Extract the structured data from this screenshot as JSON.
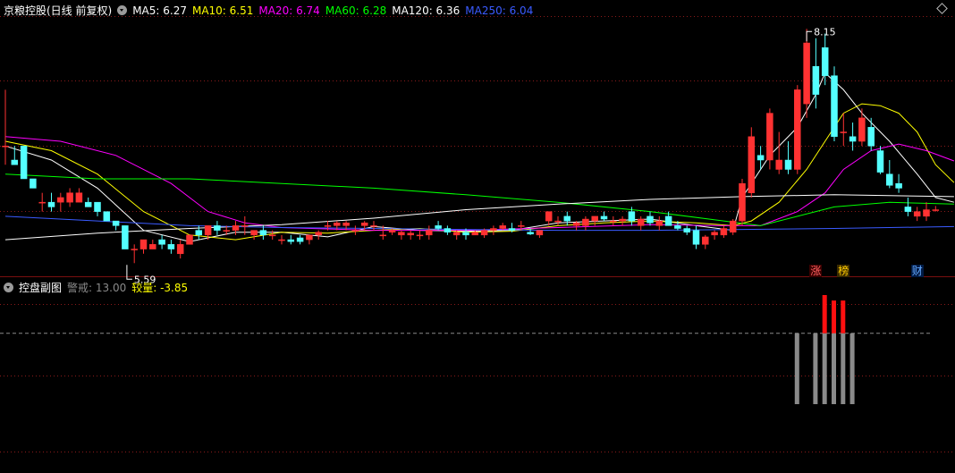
{
  "header": {
    "stock_name": "京粮控股(日线 前复权)",
    "ma": [
      {
        "label": "MA5: 6.27",
        "color": "#ffffff"
      },
      {
        "label": "MA10: 6.51",
        "color": "#ffff00"
      },
      {
        "label": "MA20: 6.74",
        "color": "#ff00ff"
      },
      {
        "label": "MA60: 6.28",
        "color": "#00ff00"
      },
      {
        "label": "MA120: 6.36",
        "color": "#ffffff"
      },
      {
        "label": "MA250: 6.04",
        "color": "#3a5bff"
      }
    ]
  },
  "sub_header": {
    "indicator_name": "控盘副图",
    "warning_label": "警戒: 13.00",
    "compare_label": "较量: -3.85"
  },
  "colors": {
    "up": "#ff3232",
    "down": "#54ffff",
    "bg": "#000000",
    "grid": "#8b1a1a"
  },
  "chart_data": {
    "type": "candlestick",
    "high_marker": "8.15",
    "low_marker": "5.59",
    "candles": [
      [
        6.9,
        7.5,
        6.7,
        6.9
      ],
      [
        6.75,
        6.9,
        6.7,
        6.7
      ],
      [
        6.9,
        6.9,
        6.55,
        6.55
      ],
      [
        6.55,
        6.55,
        6.45,
        6.45
      ],
      [
        6.3,
        6.4,
        6.2,
        6.3
      ],
      [
        6.3,
        6.4,
        6.2,
        6.25
      ],
      [
        6.3,
        6.4,
        6.2,
        6.35
      ],
      [
        6.3,
        6.45,
        6.25,
        6.4
      ],
      [
        6.3,
        6.45,
        6.3,
        6.4
      ],
      [
        6.3,
        6.35,
        6.25,
        6.25
      ],
      [
        6.3,
        6.3,
        6.15,
        6.2
      ],
      [
        6.2,
        6.2,
        6.1,
        6.1
      ],
      [
        6.1,
        6.1,
        6.0,
        6.05
      ],
      [
        6.05,
        6.05,
        5.8,
        5.8
      ],
      [
        5.8,
        5.85,
        5.65,
        5.8
      ],
      [
        5.8,
        5.9,
        5.75,
        5.9
      ],
      [
        5.8,
        5.9,
        5.8,
        5.85
      ],
      [
        5.9,
        5.95,
        5.8,
        5.85
      ],
      [
        5.85,
        5.9,
        5.75,
        5.8
      ],
      [
        5.75,
        5.9,
        5.7,
        5.85
      ],
      [
        5.85,
        5.95,
        5.85,
        5.95
      ],
      [
        6.0,
        6.05,
        5.9,
        5.95
      ],
      [
        5.95,
        6.05,
        5.9,
        6.05
      ],
      [
        6.05,
        6.1,
        5.95,
        6.0
      ],
      [
        6.0,
        6.05,
        5.95,
        6.0
      ],
      [
        6.0,
        6.1,
        5.95,
        6.05
      ],
      [
        6.05,
        6.15,
        5.95,
        6.05
      ],
      [
        5.95,
        6.0,
        5.9,
        6.0
      ],
      [
        6.0,
        6.05,
        5.9,
        5.95
      ],
      [
        5.95,
        6.0,
        5.9,
        5.95
      ],
      [
        5.9,
        5.95,
        5.85,
        5.9
      ],
      [
        5.9,
        5.95,
        5.85,
        5.88
      ],
      [
        5.92,
        5.95,
        5.85,
        5.88
      ],
      [
        5.9,
        5.95,
        5.85,
        5.95
      ],
      [
        5.95,
        6.0,
        5.9,
        5.98
      ],
      [
        6.05,
        6.1,
        6.0,
        6.05
      ],
      [
        6.05,
        6.1,
        6.0,
        6.08
      ],
      [
        6.05,
        6.1,
        6.0,
        6.08
      ],
      [
        6.0,
        6.05,
        5.95,
        6.0
      ],
      [
        6.05,
        6.1,
        6.0,
        6.08
      ],
      [
        6.05,
        6.1,
        6.0,
        6.05
      ],
      [
        5.95,
        6.05,
        5.9,
        5.95
      ],
      [
        5.98,
        6.02,
        5.95,
        6.0
      ],
      [
        5.95,
        6.0,
        5.9,
        5.98
      ],
      [
        5.95,
        6.0,
        5.9,
        5.97
      ],
      [
        5.95,
        6.0,
        5.9,
        5.95
      ],
      [
        5.95,
        6.05,
        5.9,
        6.0
      ],
      [
        6.05,
        6.1,
        6.0,
        6.02
      ],
      [
        6.02,
        6.05,
        5.95,
        5.98
      ],
      [
        5.95,
        6.0,
        5.9,
        5.98
      ],
      [
        5.98,
        6.02,
        5.9,
        5.95
      ],
      [
        5.95,
        6.0,
        5.95,
        5.98
      ],
      [
        5.95,
        6.02,
        5.92,
        6.0
      ],
      [
        6.0,
        6.05,
        5.95,
        6.02
      ],
      [
        6.02,
        6.08,
        6.0,
        6.05
      ],
      [
        6.02,
        6.08,
        5.98,
        6.0
      ],
      [
        6.05,
        6.1,
        6.0,
        6.05
      ],
      [
        5.98,
        6.02,
        5.95,
        5.96
      ],
      [
        5.95,
        6.0,
        5.92,
        6.0
      ],
      [
        6.1,
        6.2,
        6.05,
        6.2
      ],
      [
        6.1,
        6.15,
        6.05,
        6.1
      ],
      [
        6.15,
        6.2,
        6.05,
        6.1
      ],
      [
        6.05,
        6.1,
        6.0,
        6.08
      ],
      [
        6.05,
        6.15,
        6.0,
        6.12
      ],
      [
        6.1,
        6.15,
        6.05,
        6.15
      ],
      [
        6.15,
        6.2,
        6.1,
        6.12
      ],
      [
        6.1,
        6.15,
        6.05,
        6.1
      ],
      [
        6.1,
        6.15,
        6.05,
        6.12
      ],
      [
        6.2,
        6.25,
        6.05,
        6.1
      ],
      [
        6.05,
        6.15,
        6.0,
        6.12
      ],
      [
        6.15,
        6.2,
        6.05,
        6.08
      ],
      [
        6.05,
        6.15,
        6.0,
        6.1
      ],
      [
        6.15,
        6.2,
        6.05,
        6.05
      ],
      [
        6.05,
        6.1,
        6.0,
        6.02
      ],
      [
        6.02,
        6.05,
        5.95,
        5.98
      ],
      [
        6.0,
        6.05,
        5.8,
        5.85
      ],
      [
        5.85,
        5.95,
        5.8,
        5.93
      ],
      [
        5.95,
        6.0,
        5.9,
        5.98
      ],
      [
        5.95,
        6.05,
        5.92,
        6.02
      ],
      [
        5.98,
        6.12,
        5.95,
        6.1
      ],
      [
        6.1,
        6.55,
        6.05,
        6.5
      ],
      [
        6.4,
        7.1,
        6.35,
        7.0
      ],
      [
        6.8,
        6.9,
        6.65,
        6.75
      ],
      [
        6.75,
        7.3,
        6.65,
        7.25
      ],
      [
        6.65,
        7.05,
        6.6,
        6.75
      ],
      [
        6.75,
        6.95,
        6.6,
        6.65
      ],
      [
        6.65,
        7.55,
        6.6,
        7.5
      ],
      [
        7.35,
        8.15,
        7.2,
        8.0
      ],
      [
        7.75,
        8.05,
        7.3,
        7.45
      ],
      [
        7.95,
        8.1,
        7.55,
        7.65
      ],
      [
        7.65,
        7.75,
        6.95,
        7.0
      ],
      [
        7.05,
        7.25,
        6.9,
        7.05
      ],
      [
        7.0,
        7.15,
        6.85,
        6.95
      ],
      [
        6.95,
        7.3,
        6.9,
        7.2
      ],
      [
        7.1,
        7.2,
        6.85,
        6.9
      ],
      [
        6.85,
        6.9,
        6.6,
        6.62
      ],
      [
        6.6,
        6.75,
        6.45,
        6.48
      ],
      [
        6.5,
        6.6,
        6.4,
        6.45
      ],
      [
        6.25,
        6.35,
        6.15,
        6.2
      ],
      [
        6.15,
        6.25,
        6.1,
        6.2
      ],
      [
        6.15,
        6.3,
        6.1,
        6.22
      ],
      [
        6.22,
        6.26,
        6.2,
        6.22
      ]
    ],
    "ma_lines": [
      {
        "name": "MA5",
        "color": "#ffffff",
        "values": [
          [
            0,
            6.9
          ],
          [
            5,
            6.75
          ],
          [
            10,
            6.45
          ],
          [
            15,
            6.0
          ],
          [
            20,
            5.88
          ],
          [
            25,
            5.98
          ],
          [
            30,
            5.98
          ],
          [
            35,
            5.93
          ],
          [
            40,
            6.04
          ],
          [
            45,
            6.0
          ],
          [
            50,
            5.99
          ],
          [
            55,
            6.0
          ],
          [
            60,
            6.08
          ],
          [
            65,
            6.1
          ],
          [
            70,
            6.12
          ],
          [
            75,
            6.05
          ],
          [
            79,
            6.0
          ],
          [
            80,
            6.35
          ],
          [
            83,
            6.8
          ],
          [
            86,
            7.1
          ],
          [
            88,
            7.45
          ],
          [
            89,
            7.68
          ],
          [
            91,
            7.5
          ],
          [
            93,
            7.25
          ],
          [
            96,
            6.95
          ],
          [
            99,
            6.6
          ],
          [
            101,
            6.35
          ],
          [
            103,
            6.3
          ]
        ]
      },
      {
        "name": "MA10",
        "color": "#ffff00",
        "values": [
          [
            0,
            6.95
          ],
          [
            5,
            6.85
          ],
          [
            10,
            6.6
          ],
          [
            15,
            6.2
          ],
          [
            20,
            5.95
          ],
          [
            25,
            5.9
          ],
          [
            30,
            5.98
          ],
          [
            35,
            5.97
          ],
          [
            40,
            6.0
          ],
          [
            45,
            6.02
          ],
          [
            50,
            5.98
          ],
          [
            55,
            5.99
          ],
          [
            60,
            6.05
          ],
          [
            65,
            6.08
          ],
          [
            70,
            6.1
          ],
          [
            75,
            6.08
          ],
          [
            79,
            6.05
          ],
          [
            81,
            6.1
          ],
          [
            84,
            6.3
          ],
          [
            87,
            6.65
          ],
          [
            89,
            6.95
          ],
          [
            91,
            7.25
          ],
          [
            93,
            7.35
          ],
          [
            95,
            7.33
          ],
          [
            97,
            7.25
          ],
          [
            99,
            7.05
          ],
          [
            101,
            6.7
          ],
          [
            103,
            6.51
          ]
        ]
      },
      {
        "name": "MA20",
        "color": "#ff00ff",
        "values": [
          [
            0,
            7.0
          ],
          [
            6,
            6.95
          ],
          [
            12,
            6.8
          ],
          [
            18,
            6.5
          ],
          [
            22,
            6.2
          ],
          [
            26,
            6.08
          ],
          [
            30,
            6.03
          ],
          [
            40,
            6.0
          ],
          [
            50,
            6.0
          ],
          [
            60,
            6.03
          ],
          [
            70,
            6.06
          ],
          [
            78,
            6.05
          ],
          [
            82,
            6.05
          ],
          [
            86,
            6.2
          ],
          [
            89,
            6.4
          ],
          [
            91,
            6.65
          ],
          [
            94,
            6.85
          ],
          [
            97,
            6.92
          ],
          [
            100,
            6.85
          ],
          [
            103,
            6.74
          ]
        ]
      },
      {
        "name": "MA60",
        "color": "#00ff00",
        "values": [
          [
            0,
            6.6
          ],
          [
            10,
            6.55
          ],
          [
            20,
            6.55
          ],
          [
            30,
            6.5
          ],
          [
            40,
            6.45
          ],
          [
            50,
            6.38
          ],
          [
            60,
            6.3
          ],
          [
            70,
            6.2
          ],
          [
            78,
            6.1
          ],
          [
            82,
            6.05
          ],
          [
            86,
            6.15
          ],
          [
            90,
            6.25
          ],
          [
            96,
            6.3
          ],
          [
            103,
            6.28
          ]
        ]
      },
      {
        "name": "MA120",
        "color": "#ffffff",
        "values": [
          [
            0,
            5.9
          ],
          [
            10,
            5.97
          ],
          [
            20,
            6.02
          ],
          [
            30,
            6.06
          ],
          [
            40,
            6.13
          ],
          [
            50,
            6.22
          ],
          [
            60,
            6.28
          ],
          [
            70,
            6.33
          ],
          [
            80,
            6.36
          ],
          [
            90,
            6.38
          ],
          [
            103,
            6.36
          ]
        ]
      },
      {
        "name": "MA250",
        "color": "#3a5bff",
        "values": [
          [
            0,
            6.15
          ],
          [
            10,
            6.1
          ],
          [
            20,
            6.05
          ],
          [
            30,
            6.03
          ],
          [
            40,
            6.02
          ],
          [
            50,
            6.01
          ],
          [
            60,
            6.0
          ],
          [
            70,
            6.0
          ],
          [
            80,
            6.01
          ],
          [
            90,
            6.02
          ],
          [
            103,
            6.04
          ]
        ]
      }
    ],
    "badges": [
      {
        "text": "涨",
        "index": 88,
        "color": "#ff6060",
        "bg": "#3a0000"
      },
      {
        "text": "榜",
        "index": 91,
        "color": "#ffcc00",
        "bg": "#3a2a00"
      },
      {
        "text": "财",
        "index": 99,
        "color": "#66aaff",
        "bg": "#001a44"
      }
    ],
    "sub_bars": [
      {
        "index": 86,
        "gray": 13,
        "red": 0
      },
      {
        "index": 88,
        "gray": 13,
        "red": 0
      },
      {
        "index": 89,
        "gray": 13,
        "red": 7
      },
      {
        "index": 90,
        "gray": 13,
        "red": 6
      },
      {
        "index": 91,
        "gray": 13,
        "red": 6
      },
      {
        "index": 92,
        "gray": 13,
        "red": 0
      }
    ],
    "sub_warning": 13
  }
}
